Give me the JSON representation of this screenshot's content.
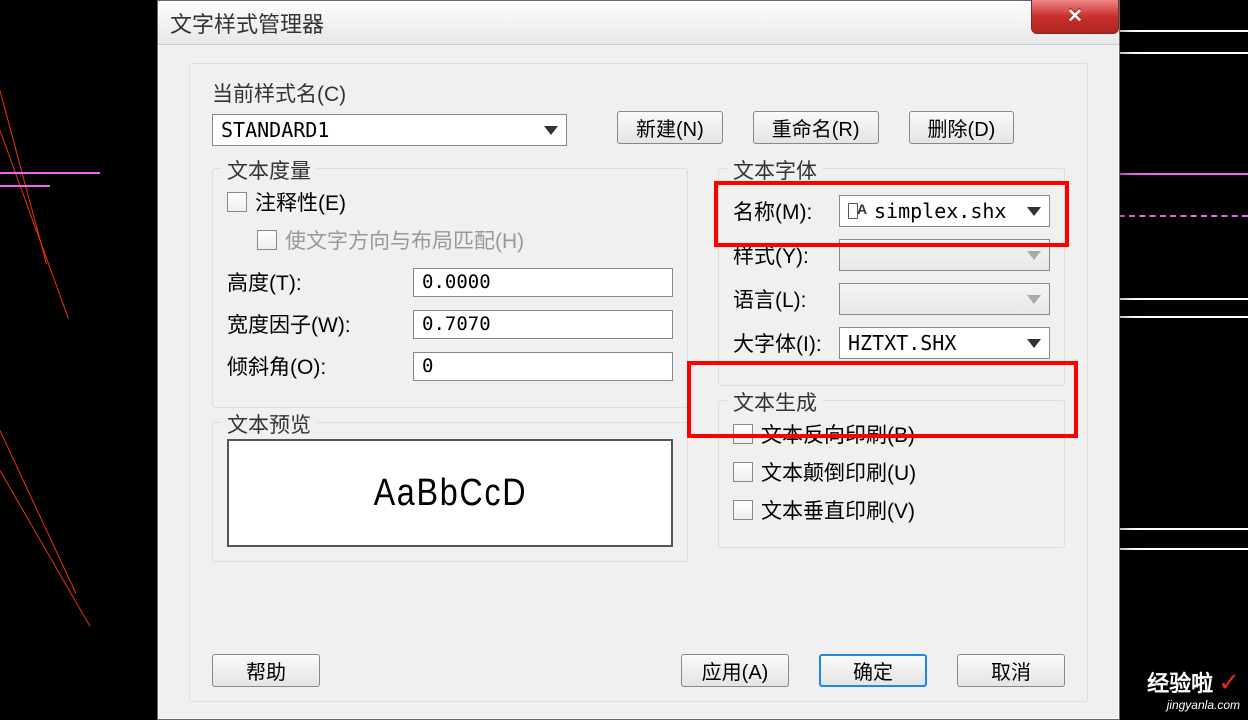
{
  "dialog": {
    "title": "文字样式管理器",
    "close_icon": "✕"
  },
  "current_style": {
    "label": "当前样式名(C)",
    "value": "STANDARD1"
  },
  "buttons": {
    "new": "新建(N)",
    "rename": "重命名(R)",
    "delete": "删除(D)",
    "help": "帮助",
    "apply": "应用(A)",
    "ok": "确定",
    "cancel": "取消"
  },
  "measure": {
    "title": "文本度量",
    "annotative": "注释性(E)",
    "match_orient": "使文字方向与布局匹配(H)",
    "height_label": "高度(T):",
    "height_value": "0.0000",
    "width_label": "宽度因子(W):",
    "width_value": "0.7070",
    "oblique_label": "倾斜角(O):",
    "oblique_value": "0"
  },
  "font": {
    "title": "文本字体",
    "name_label": "名称(M):",
    "name_value": "simplex.shx",
    "style_label": "样式(Y):",
    "style_value": "",
    "lang_label": "语言(L):",
    "lang_value": "",
    "big_label": "大字体(I):",
    "big_value": "HZTXT.SHX"
  },
  "preview": {
    "title": "文本预览",
    "sample": "AaBbCcD"
  },
  "generate": {
    "title": "文本生成",
    "backward": "文本反向印刷(B)",
    "upside": "文本颠倒印刷(U)",
    "vertical": "文本垂直印刷(V)"
  },
  "watermark": {
    "top": "经验啦",
    "bottom": "jingyanla.com"
  }
}
